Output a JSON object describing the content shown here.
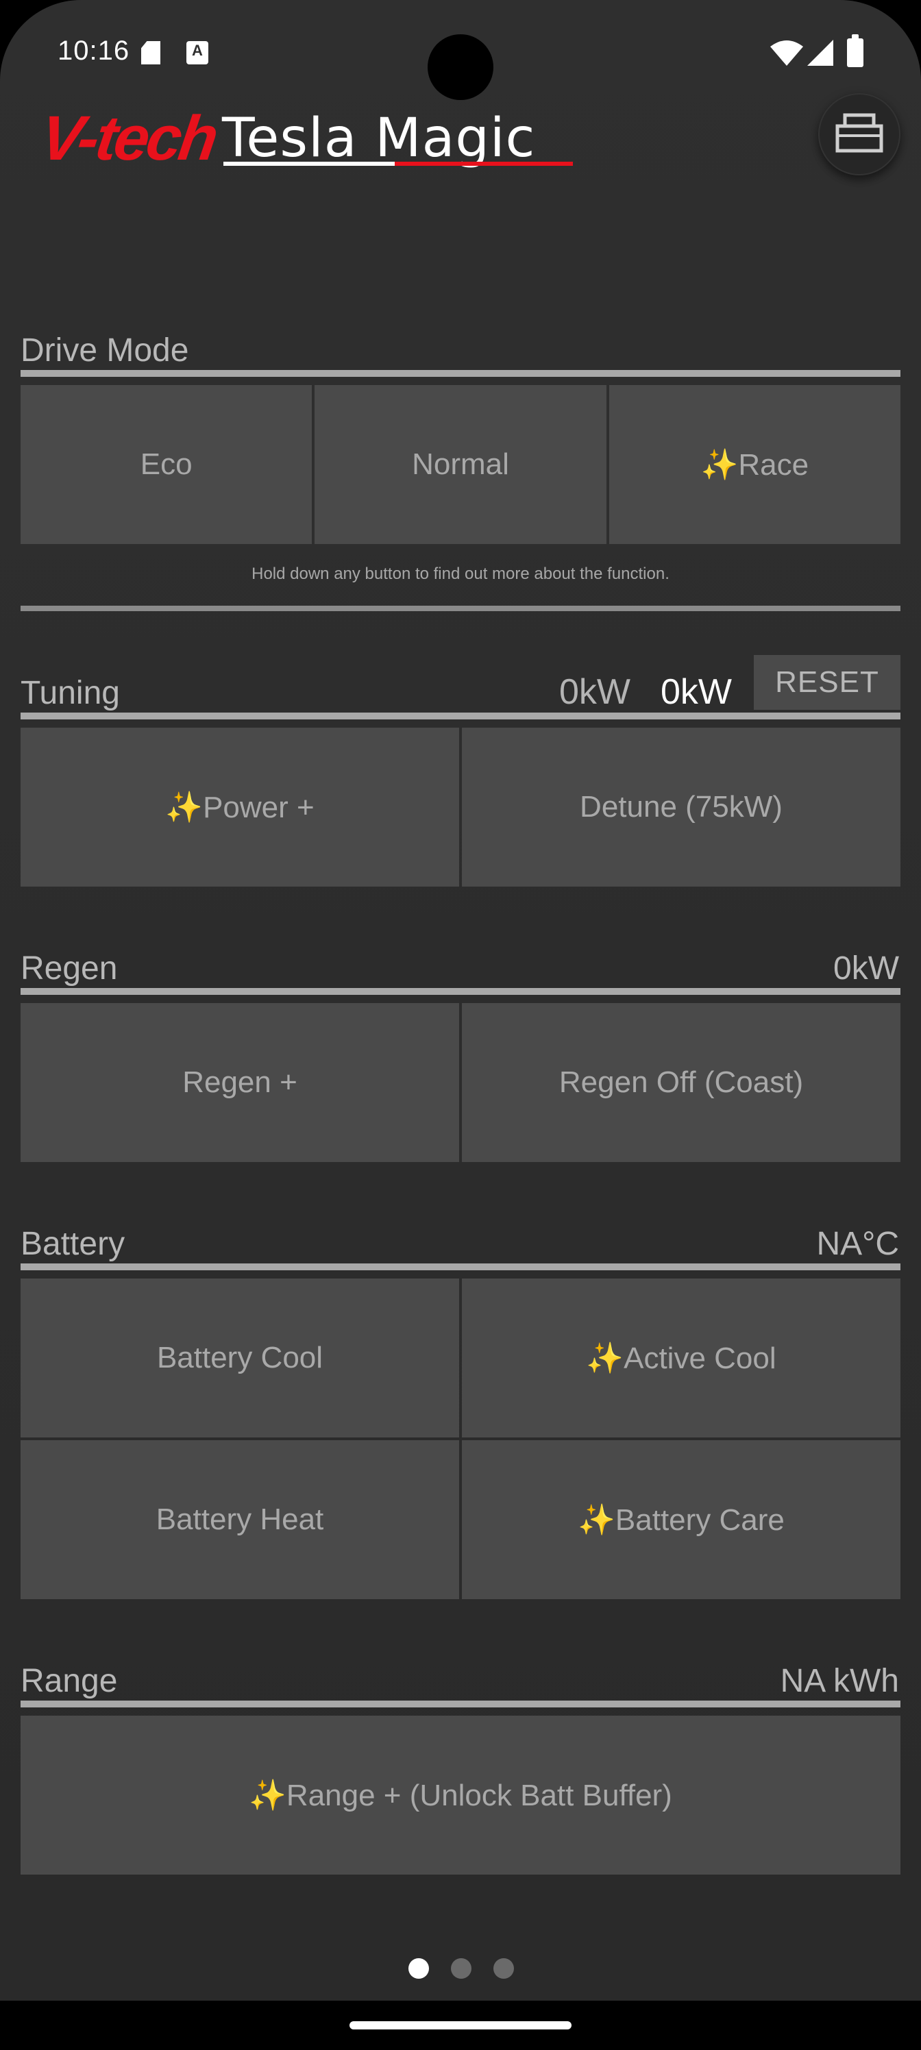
{
  "status_bar": {
    "time": "10:16",
    "icons": [
      "sd-card-icon",
      "a-icon",
      "wifi-icon",
      "cell-signal-icon",
      "battery-icon"
    ],
    "a_glyph": "A"
  },
  "header": {
    "logo_brand": "V-tech",
    "logo_title": "Tesla Magic",
    "obd_icon": "obd-adapter-icon"
  },
  "drive_mode": {
    "title": "Drive Mode",
    "buttons": [
      "Eco",
      "Normal",
      "✨Race"
    ],
    "hint": "Hold down any button to find out more about the function."
  },
  "tuning": {
    "title": "Tuning",
    "value_1": "0kW",
    "value_2": "0kW",
    "reset_label": "RESET",
    "buttons": [
      "✨Power +",
      "Detune (75kW)"
    ]
  },
  "regen": {
    "title": "Regen",
    "value": "0kW",
    "buttons": [
      "Regen +",
      "Regen Off (Coast)"
    ]
  },
  "battery": {
    "title": "Battery",
    "value": "NA°C",
    "buttons": [
      "Battery Cool",
      "✨Active Cool",
      "Battery Heat",
      "✨Battery Care"
    ]
  },
  "range": {
    "title": "Range",
    "value": "NA kWh",
    "buttons": [
      "✨Range + (Unlock Batt Buffer)"
    ]
  },
  "pager": {
    "pages": 3,
    "current_page": 1
  },
  "colors": {
    "background": "#2d2d2d",
    "button": "#4a4a4a",
    "brand_red": "#e8111c",
    "rule": "#a9a9a9",
    "text": "#a9a9a9"
  }
}
